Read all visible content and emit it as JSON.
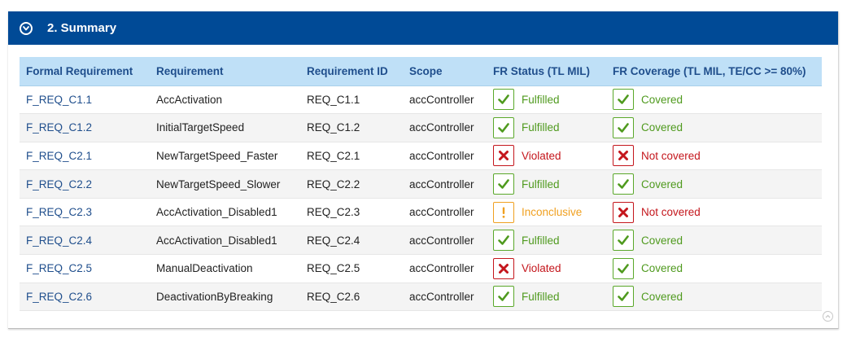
{
  "section": {
    "title": "2. Summary",
    "colors": {
      "header_bg": "#004a96",
      "table_header_bg": "#bfe0f7",
      "ok": "#4f9a1e",
      "bad": "#c4161c",
      "warn": "#f0a020"
    }
  },
  "table": {
    "headers": [
      "Formal Requirement",
      "Requirement",
      "Requirement ID",
      "Scope",
      "FR Status (TL MIL)",
      "FR Coverage (TL MIL, TE/CC >= 80%)"
    ],
    "rows": [
      {
        "fr": "F_REQ_C1.1",
        "req": "AccActivation",
        "id": "REQ_C1.1",
        "scope": "accController",
        "status": "Fulfilled",
        "status_kind": "ok",
        "status_icon": "check-icon",
        "coverage": "Covered",
        "coverage_kind": "ok",
        "coverage_icon": "check-icon"
      },
      {
        "fr": "F_REQ_C1.2",
        "req": "InitialTargetSpeed",
        "id": "REQ_C1.2",
        "scope": "accController",
        "status": "Fulfilled",
        "status_kind": "ok",
        "status_icon": "check-icon",
        "coverage": "Covered",
        "coverage_kind": "ok",
        "coverage_icon": "check-icon"
      },
      {
        "fr": "F_REQ_C2.1",
        "req": "NewTargetSpeed_Faster",
        "id": "REQ_C2.1",
        "scope": "accController",
        "status": "Violated",
        "status_kind": "bad",
        "status_icon": "cross-icon",
        "coverage": "Not covered",
        "coverage_kind": "bad",
        "coverage_icon": "cross-icon"
      },
      {
        "fr": "F_REQ_C2.2",
        "req": "NewTargetSpeed_Slower",
        "id": "REQ_C2.2",
        "scope": "accController",
        "status": "Fulfilled",
        "status_kind": "ok",
        "status_icon": "check-icon",
        "coverage": "Covered",
        "coverage_kind": "ok",
        "coverage_icon": "check-icon"
      },
      {
        "fr": "F_REQ_C2.3",
        "req": "AccActivation_Disabled1",
        "id": "REQ_C2.3",
        "scope": "accController",
        "status": "Inconclusive",
        "status_kind": "warn",
        "status_icon": "exclamation-icon",
        "coverage": "Not covered",
        "coverage_kind": "bad",
        "coverage_icon": "cross-icon"
      },
      {
        "fr": "F_REQ_C2.4",
        "req": "AccActivation_Disabled1",
        "id": "REQ_C2.4",
        "scope": "accController",
        "status": "Fulfilled",
        "status_kind": "ok",
        "status_icon": "check-icon",
        "coverage": "Covered",
        "coverage_kind": "ok",
        "coverage_icon": "check-icon"
      },
      {
        "fr": "F_REQ_C2.5",
        "req": "ManualDeactivation",
        "id": "REQ_C2.5",
        "scope": "accController",
        "status": "Violated",
        "status_kind": "bad",
        "status_icon": "cross-icon",
        "coverage": "Covered",
        "coverage_kind": "ok",
        "coverage_icon": "check-icon"
      },
      {
        "fr": "F_REQ_C2.6",
        "req": "DeactivationByBreaking",
        "id": "REQ_C2.6",
        "scope": "accController",
        "status": "Fulfilled",
        "status_kind": "ok",
        "status_icon": "check-icon",
        "coverage": "Covered",
        "coverage_kind": "ok",
        "coverage_icon": "check-icon"
      }
    ]
  }
}
